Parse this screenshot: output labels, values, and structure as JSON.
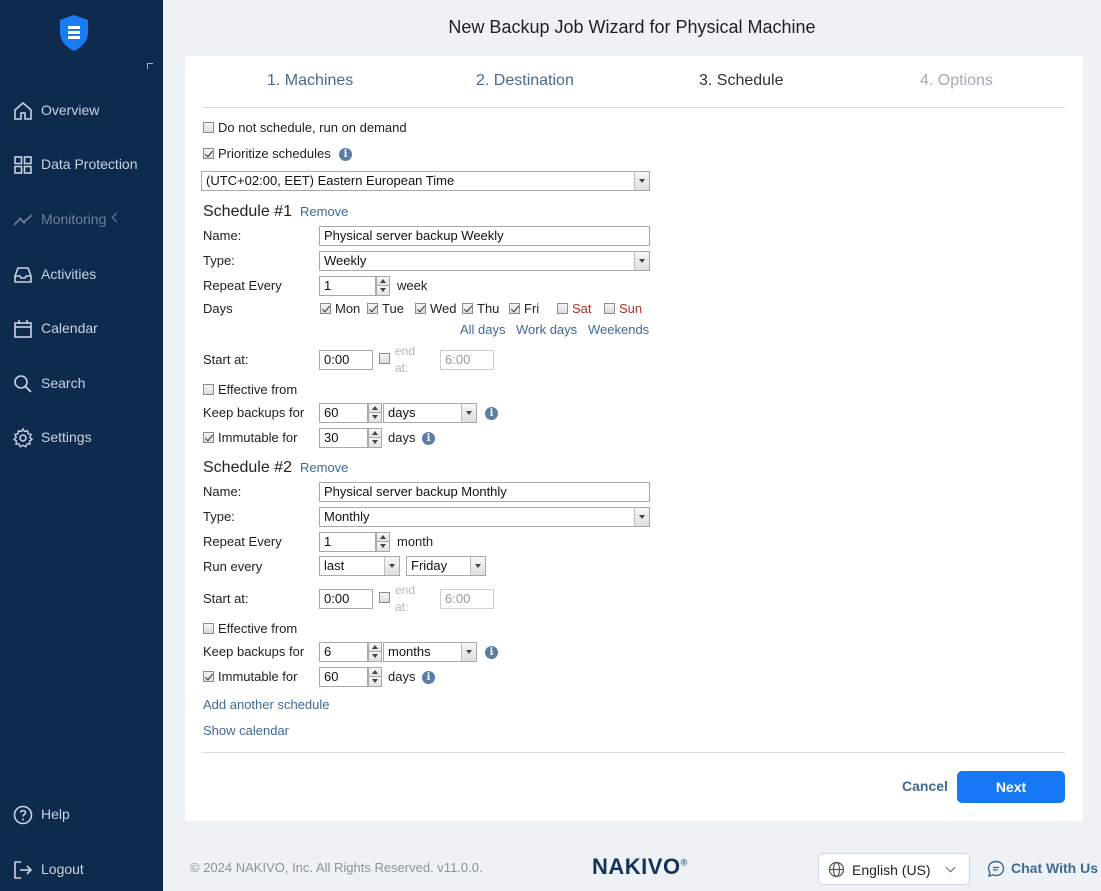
{
  "sidebar": {
    "items": [
      {
        "label": "Overview",
        "icon": "home-icon"
      },
      {
        "label": "Data Protection",
        "icon": "grid-icon"
      },
      {
        "label": "Monitoring",
        "icon": "activity-chart-icon"
      },
      {
        "label": "Activities",
        "icon": "inbox-icon"
      },
      {
        "label": "Calendar",
        "icon": "calendar-icon"
      },
      {
        "label": "Search",
        "icon": "search-icon"
      },
      {
        "label": "Settings",
        "icon": "gear-icon"
      }
    ],
    "help": "Help",
    "logout": "Logout"
  },
  "wizard": {
    "title": "New Backup Job Wizard for Physical Machine",
    "steps": [
      "1. Machines",
      "2. Destination",
      "3. Schedule",
      "4. Options"
    ],
    "active_step": 3
  },
  "schedule": {
    "do_not_schedule": {
      "label": "Do not schedule, run on demand",
      "checked": false
    },
    "prioritize": {
      "label": "Prioritize schedules",
      "checked": true
    },
    "timezone": "(UTC+02:00, EET) Eastern European Time",
    "labels": {
      "name": "Name:",
      "type": "Type:",
      "repeat_every": "Repeat Every",
      "days": "Days",
      "start_at": "Start at:",
      "end_at_1": "end",
      "end_at_2": "at:",
      "effective_from": "Effective from",
      "keep_backups": "Keep backups for",
      "immutable": "Immutable for",
      "run_every": "Run every",
      "remove": "Remove"
    },
    "schedule1": {
      "title": "Schedule #1",
      "name": "Physical server backup Weekly",
      "type": "Weekly",
      "repeat_value": "1",
      "repeat_unit": "week",
      "days": [
        {
          "label": "Mon",
          "checked": true
        },
        {
          "label": "Tue",
          "checked": true
        },
        {
          "label": "Wed",
          "checked": true
        },
        {
          "label": "Thu",
          "checked": true
        },
        {
          "label": "Fri",
          "checked": true
        },
        {
          "label": "Sat",
          "checked": false
        },
        {
          "label": "Sun",
          "checked": false
        }
      ],
      "day_links": [
        "All days",
        "Work days",
        "Weekends"
      ],
      "start_at": "0:00",
      "end_at": "6:00",
      "keep_value": "60",
      "keep_unit": "days",
      "immutable_value": "30",
      "immutable_unit": "days"
    },
    "schedule2": {
      "title": "Schedule #2",
      "name": "Physical server backup Monthly",
      "type": "Monthly",
      "repeat_value": "1",
      "repeat_unit": "month",
      "run_every_when": "last",
      "run_every_day": "Friday",
      "start_at": "0:00",
      "end_at": "6:00",
      "keep_value": "6",
      "keep_unit": "months",
      "immutable_value": "60",
      "immutable_unit": "days"
    },
    "add_schedule": "Add another schedule",
    "show_calendar": "Show calendar"
  },
  "buttons": {
    "cancel": "Cancel",
    "next": "Next"
  },
  "footer": {
    "copyright": "© 2024 NAKIVO, Inc. All Rights Reserved. v11.0.0.",
    "brand": "NAKIVO",
    "brand_mark": "®",
    "language": "English (US)",
    "chat": "Chat With Us"
  },
  "colors": {
    "sidebar": "#0e2a4d",
    "accent": "#1678f5",
    "link": "#3e6a97",
    "weekend": "#b0312a"
  }
}
